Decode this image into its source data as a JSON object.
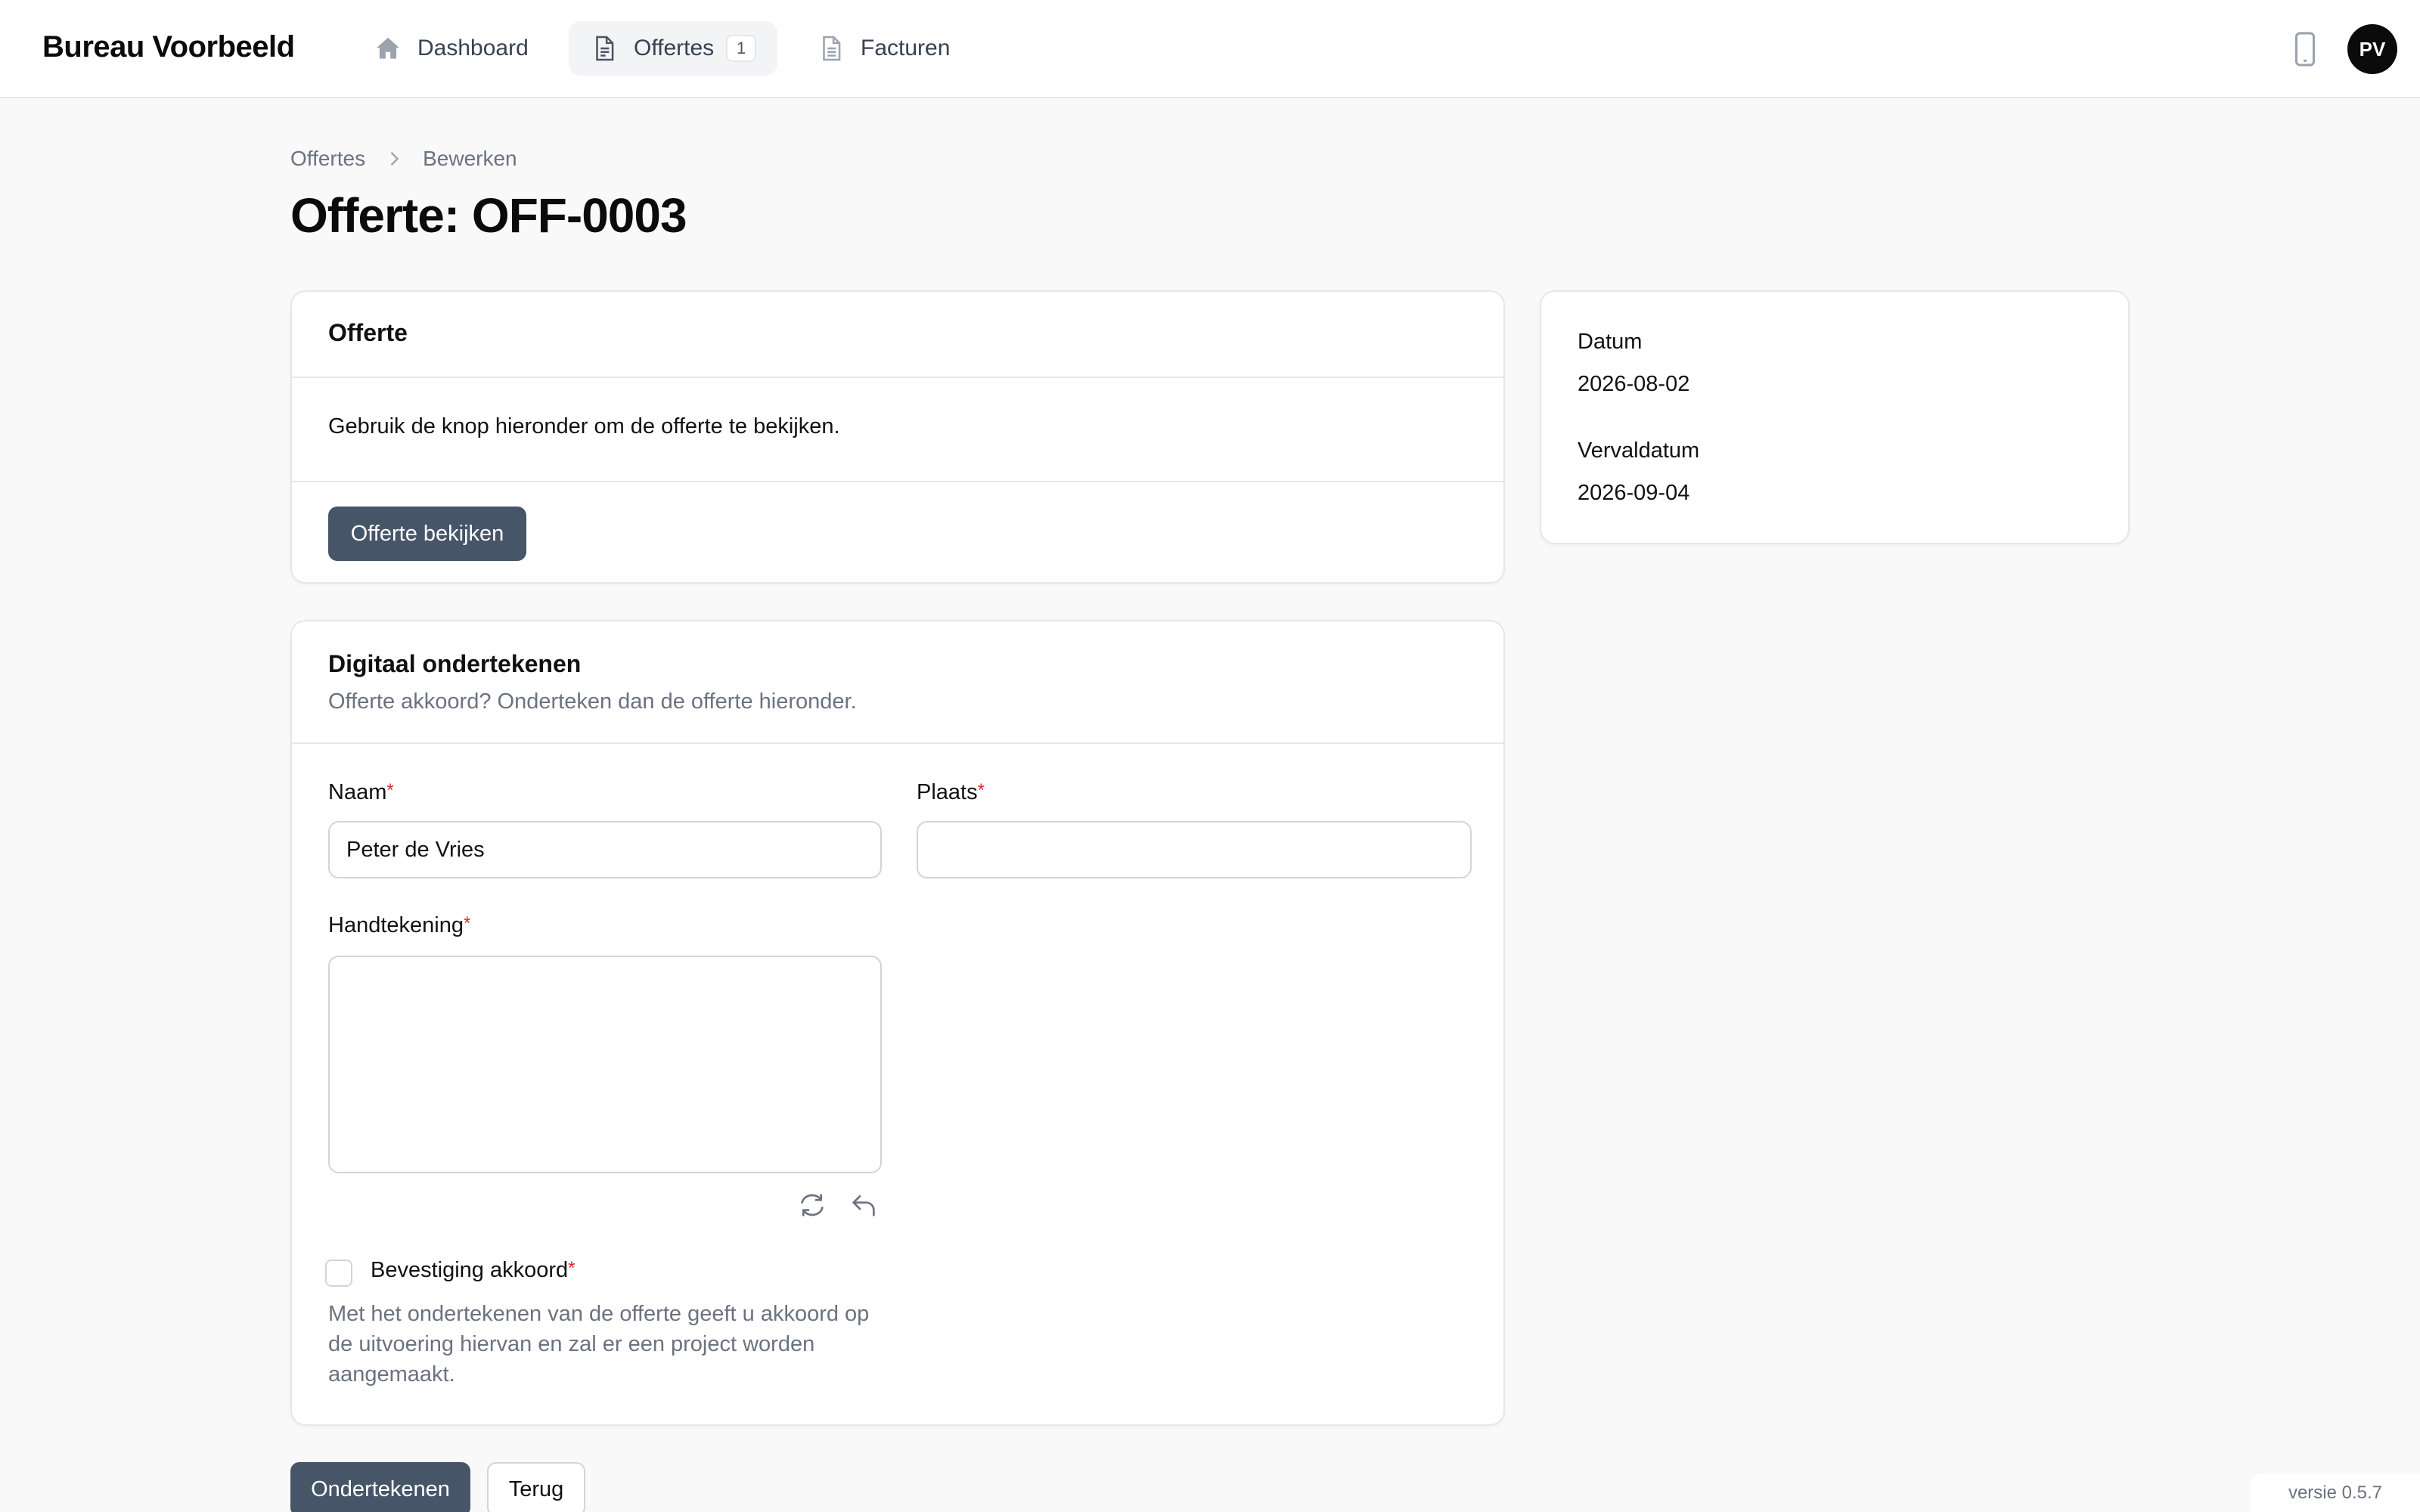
{
  "app": {
    "brand": "Bureau Voorbeeld"
  },
  "nav": {
    "dashboard": "Dashboard",
    "offertes": "Offertes",
    "offertes_badge": "1",
    "facturen": "Facturen"
  },
  "user": {
    "initials": "PV"
  },
  "breadcrumb": {
    "parent": "Offertes",
    "current": "Bewerken"
  },
  "page": {
    "title": "Offerte: OFF-0003"
  },
  "offerte_card": {
    "title": "Offerte",
    "description": "Gebruik de knop hieronder om de offerte te bekijken.",
    "view_button": "Offerte bekijken"
  },
  "meta_card": {
    "date_label": "Datum",
    "date_value": "2026-08-02",
    "due_label": "Vervaldatum",
    "due_value": "2026-09-04"
  },
  "sign_card": {
    "title": "Digitaal ondertekenen",
    "subtitle": "Offerte akkoord? Onderteken dan de offerte hieronder.",
    "name_label": "Naam",
    "name_value": "Peter de Vries",
    "place_label": "Plaats",
    "place_value": "",
    "signature_label": "Handtekening",
    "required_mark": "*",
    "confirm_label": "Bevestiging akkoord",
    "confirm_checked": false,
    "confirm_help": "Met het ondertekenen van de offerte geeft u akkoord op de uitvoering hiervan en zal er een project worden aangemaakt."
  },
  "actions": {
    "sign": "Ondertekenen",
    "back": "Terug"
  },
  "footer": {
    "version": "versie 0.5.7"
  },
  "colors": {
    "primary_button": "#475569",
    "required": "#dc2626",
    "background": "#f9f9f9"
  },
  "icons": [
    "home-icon",
    "document-icon",
    "file-icon",
    "mobile-icon",
    "chevron-right-icon",
    "refresh-icon",
    "undo-icon"
  ]
}
